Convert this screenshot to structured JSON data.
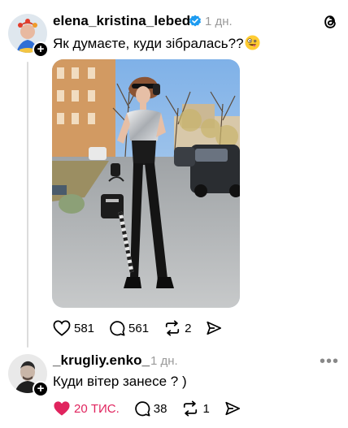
{
  "post": {
    "username": "elena_kristina_lebed",
    "time": "1 дн.",
    "text": "Як думаєте, куди зібралась??",
    "emoji_icon": "zany-face-icon",
    "likes": "581",
    "comments": "561",
    "reposts": "2"
  },
  "reply": {
    "username": "_krugliy.enko_",
    "time": "1 дн.",
    "text": "Куди вітер занесе ? )",
    "likes": "20 ТИС.",
    "comments": "38",
    "reposts": "1",
    "like_color": "#e0245e"
  },
  "app": {
    "logo_icon": "threads-logo-icon"
  }
}
